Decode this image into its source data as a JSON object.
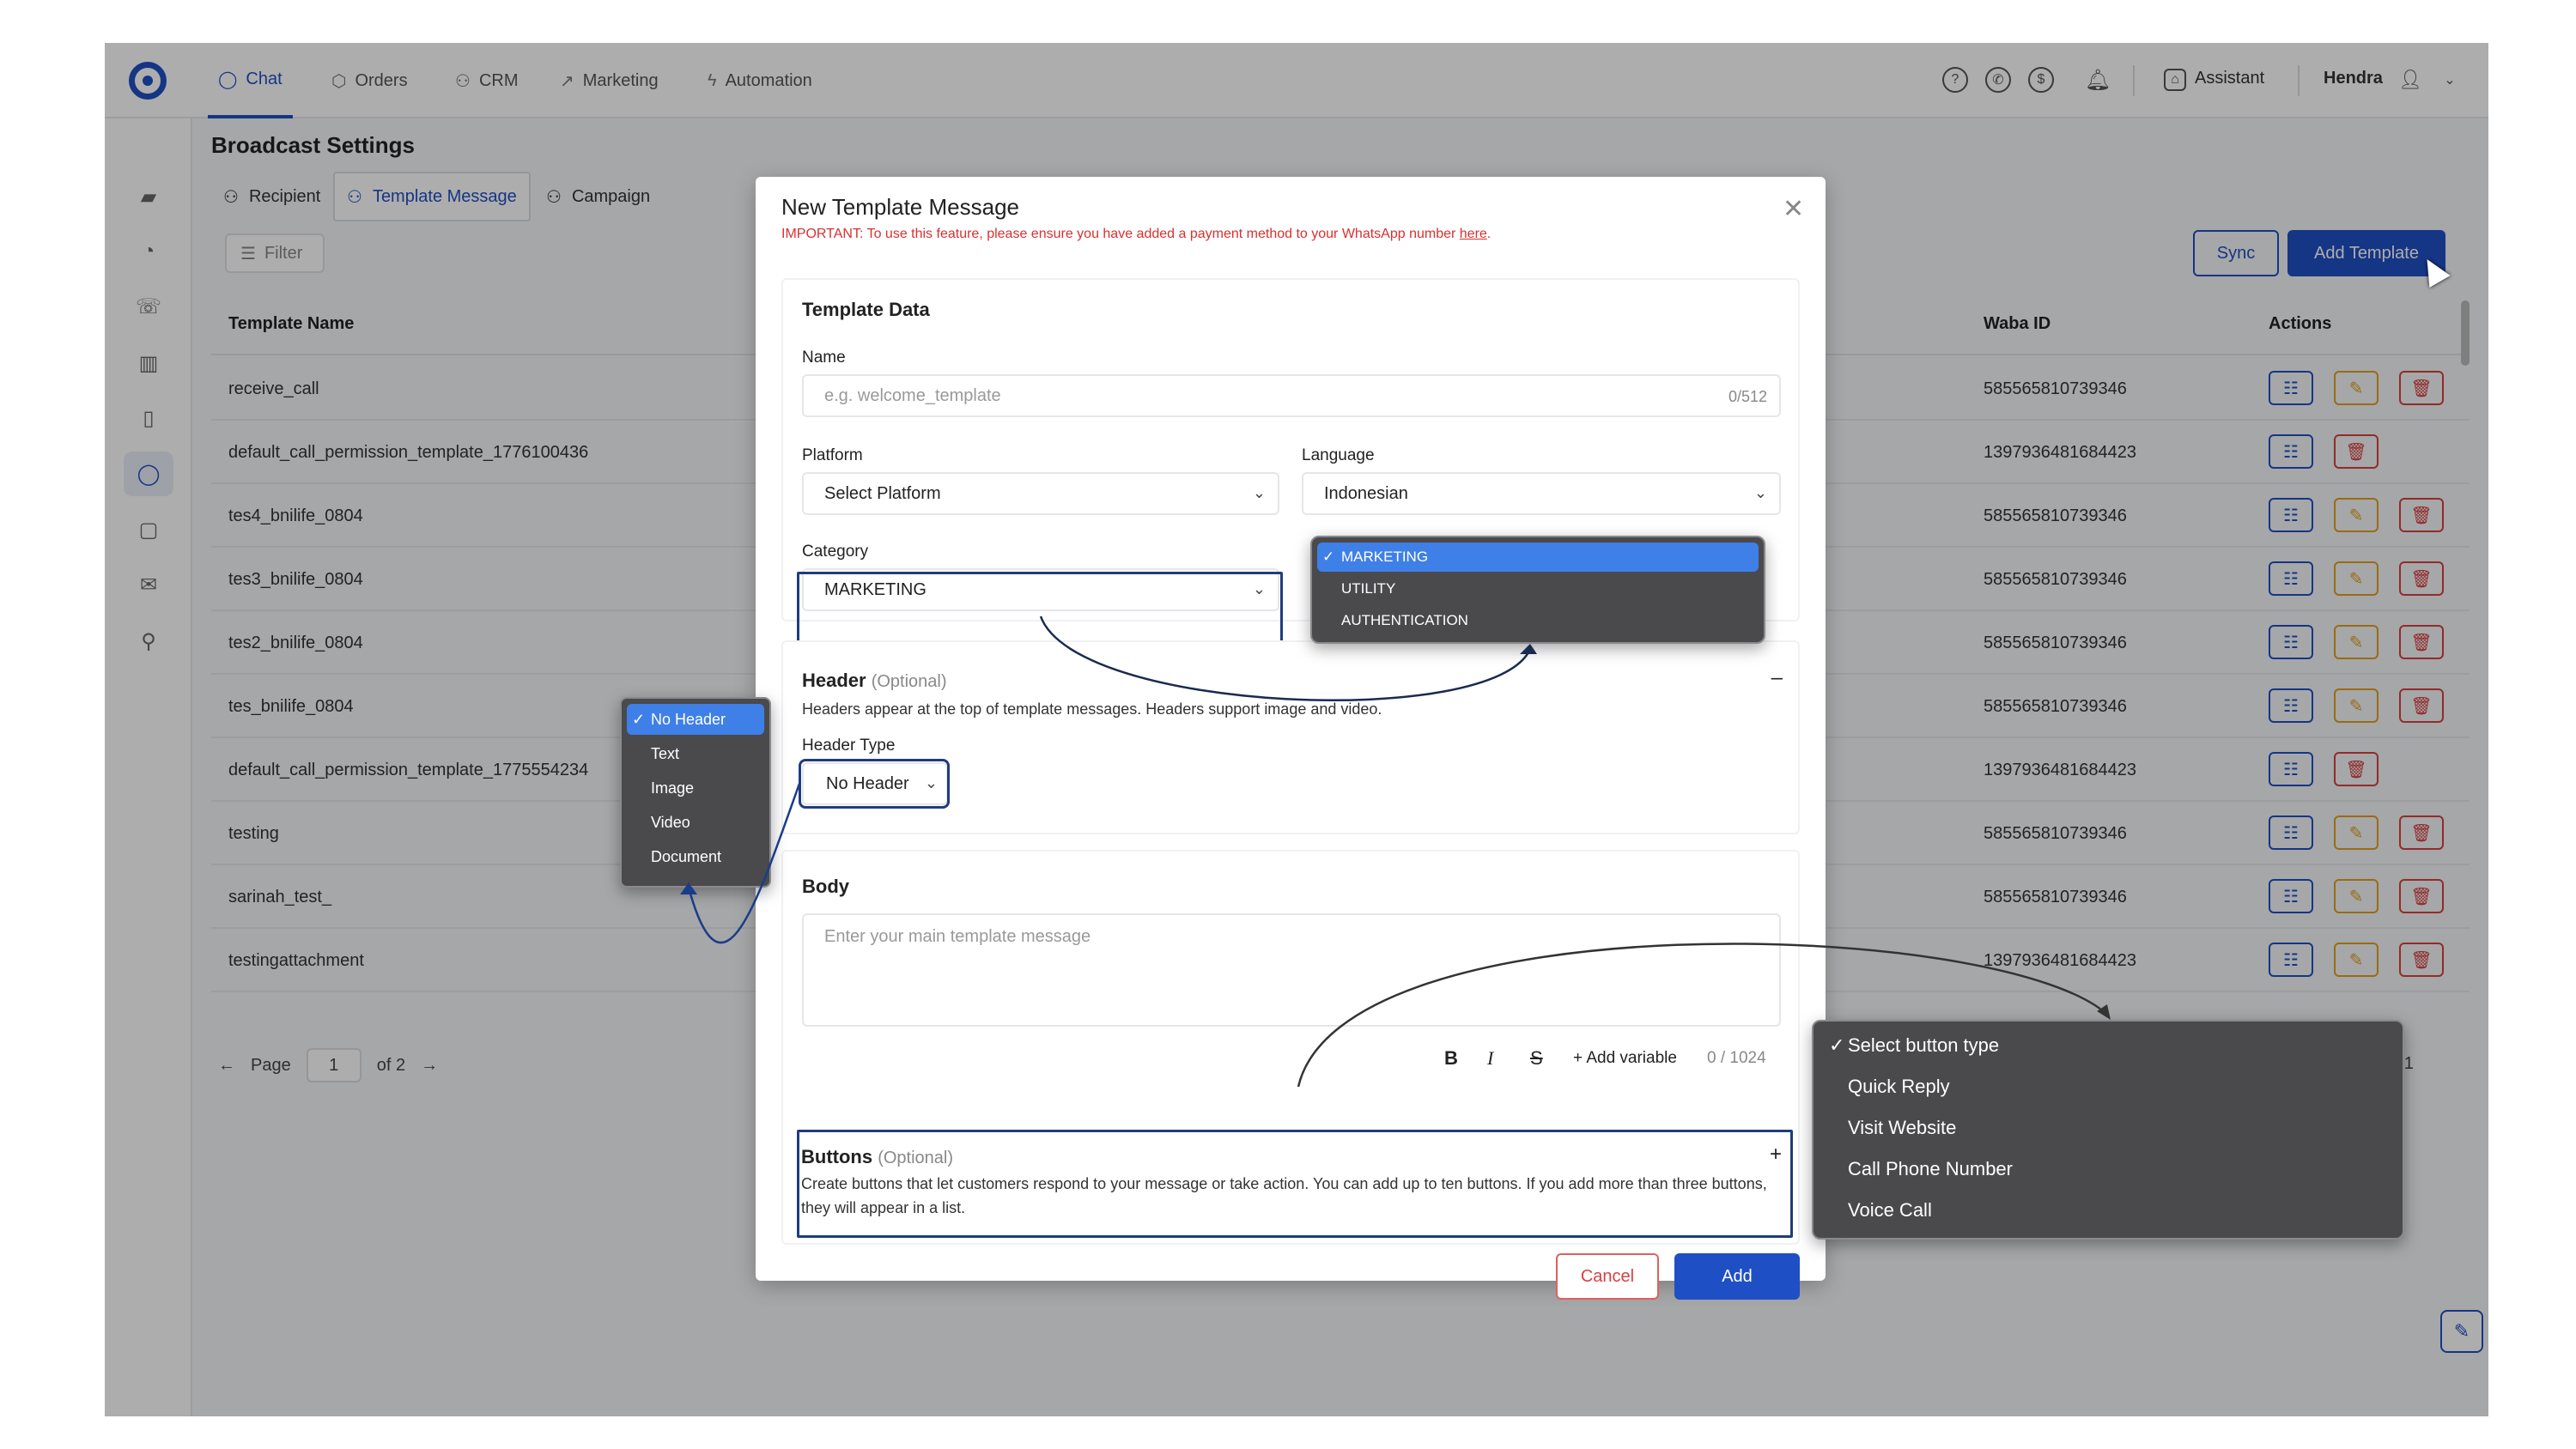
{
  "nav": {
    "tabs": [
      {
        "label": "Chat",
        "icon": "chat-bubble-icon"
      },
      {
        "label": "Orders",
        "icon": "box-icon"
      },
      {
        "label": "CRM",
        "icon": "users-icon"
      },
      {
        "label": "Marketing",
        "icon": "trend-icon"
      },
      {
        "label": "Automation",
        "icon": "bolt-icon"
      }
    ],
    "assistant_label": "Assistant",
    "user_name": "Hendra"
  },
  "page": {
    "title": "Broadcast Settings",
    "tabs": [
      "Recipient",
      "Template Message",
      "Campaign"
    ],
    "filter_label": "Filter",
    "sync_label": "Sync",
    "add_template_label": "Add Template"
  },
  "table": {
    "columns": [
      "Template Name",
      "Waba ID",
      "Actions"
    ],
    "rows": [
      {
        "name": "receive_call",
        "waba": "585565810739346",
        "actions": [
          "list",
          "edit",
          "delete"
        ]
      },
      {
        "name": "default_call_permission_template_1776100436",
        "waba": "1397936481684423",
        "actions": [
          "list",
          "delete"
        ]
      },
      {
        "name": "tes4_bnilife_0804",
        "waba": "585565810739346",
        "actions": [
          "list",
          "edit",
          "delete"
        ]
      },
      {
        "name": "tes3_bnilife_0804",
        "waba": "585565810739346",
        "actions": [
          "list",
          "edit",
          "delete"
        ]
      },
      {
        "name": "tes2_bnilife_0804",
        "waba": "585565810739346",
        "actions": [
          "list",
          "edit",
          "delete"
        ]
      },
      {
        "name": "tes_bnilife_0804",
        "waba": "585565810739346",
        "actions": [
          "list",
          "edit",
          "delete"
        ]
      },
      {
        "name": "default_call_permission_template_1775554234",
        "waba": "1397936481684423",
        "actions": [
          "list",
          "delete"
        ]
      },
      {
        "name": "testing",
        "waba": "585565810739346",
        "actions": [
          "list",
          "edit",
          "delete"
        ]
      },
      {
        "name": "sarinah_test_",
        "waba": "585565810739346",
        "actions": [
          "list",
          "edit",
          "delete"
        ]
      },
      {
        "name": "testingattachment",
        "waba": "1397936481684423",
        "actions": [
          "list",
          "edit",
          "delete"
        ]
      }
    ]
  },
  "pager": {
    "page_label": "Page",
    "page": "1",
    "of_label": "of 2",
    "total_label": "l: 101"
  },
  "modal": {
    "title": "New Template Message",
    "warning": "IMPORTANT: To use this feature, please ensure you have added a payment method to your WhatsApp number ",
    "warning_link": "here",
    "warning_end": ".",
    "template_data": {
      "title": "Template Data",
      "name_label": "Name",
      "name_placeholder": "e.g. welcome_template",
      "name_counter": "0/512",
      "platform_label": "Platform",
      "platform_value": "Select Platform",
      "language_label": "Language",
      "language_value": "Indonesian",
      "category_label": "Category",
      "category_value": "MARKETING"
    },
    "header": {
      "title": "Header",
      "optional": "(Optional)",
      "desc": "Headers appear at the top of template messages. Headers support image and video.",
      "type_label": "Header Type",
      "type_value": "No Header",
      "collapse": "–"
    },
    "body": {
      "title": "Body",
      "placeholder": "Enter your main template message",
      "bold": "B",
      "italic": "I",
      "strike": "S",
      "add_variable": "+ Add variable",
      "counter": "0 / 1024"
    },
    "buttons": {
      "title": "Buttons",
      "optional": "(Optional)",
      "desc": "Create buttons that let customers respond to your message or take action. You can add up to ten buttons. If you add more than three buttons, they will appear in a list.",
      "expand": "+"
    },
    "cancel_label": "Cancel",
    "add_label": "Add"
  },
  "dropdowns": {
    "category_options": [
      "MARKETING",
      "UTILITY",
      "AUTHENTICATION"
    ],
    "category_selected": "MARKETING",
    "header_options": [
      "No Header",
      "Text",
      "Image",
      "Video",
      "Document"
    ],
    "header_selected": "No Header",
    "button_options": [
      "Select button type",
      "Quick Reply",
      "Visit Website",
      "Call Phone Number",
      "Voice Call"
    ],
    "button_selected": "Select button type"
  },
  "colors": {
    "primary": "#1f4fc4",
    "danger": "#d84040",
    "warning": "#e0a020",
    "popup_bg": "#4a4a4c",
    "popup_sel": "#3f7fe8"
  }
}
